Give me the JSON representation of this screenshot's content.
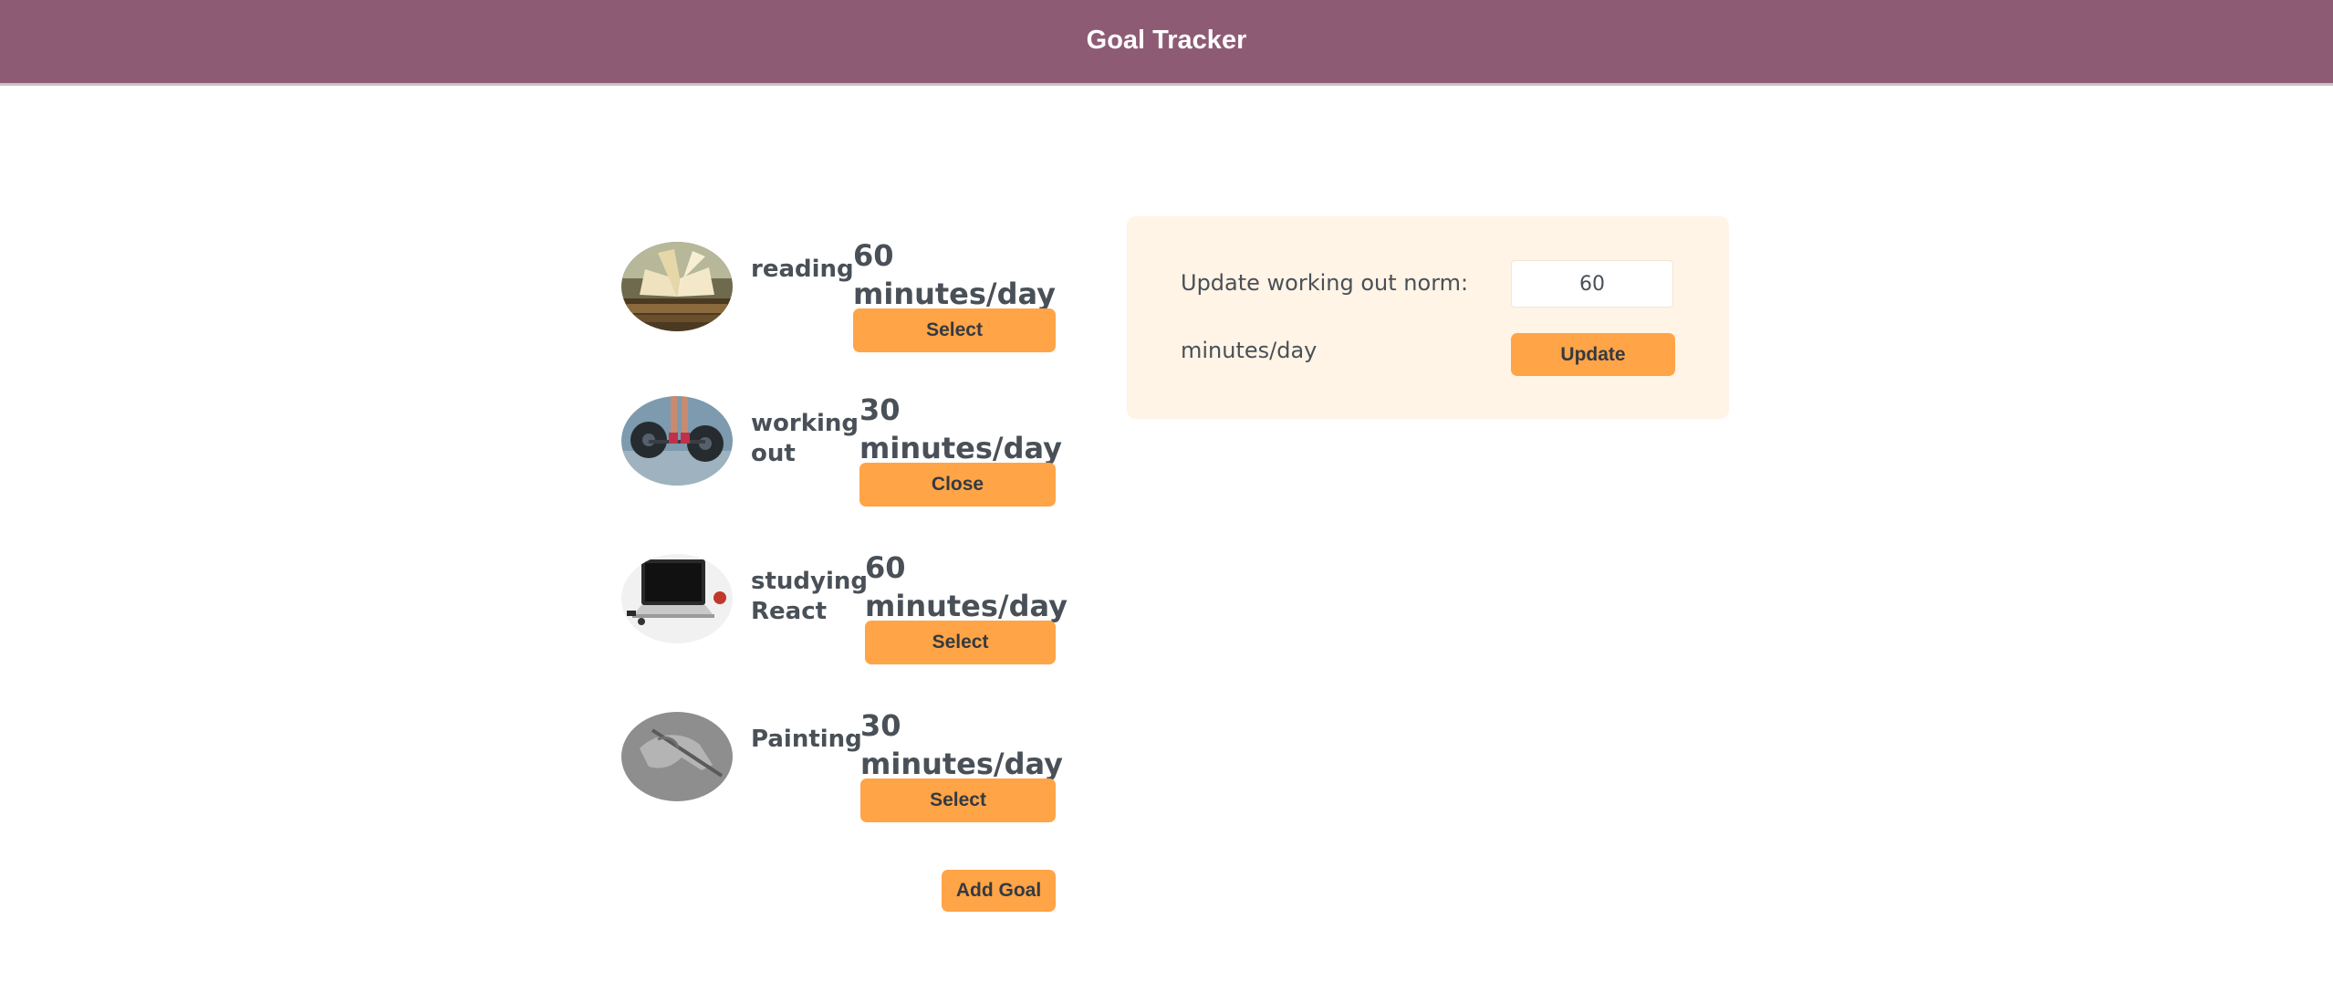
{
  "header": {
    "title": "Goal Tracker"
  },
  "goals": [
    {
      "name": "reading",
      "target": "60 minutes/day",
      "button": "Select",
      "image_icon": "open-book"
    },
    {
      "name": "working out",
      "target": "30 minutes/day",
      "button": "Close",
      "image_icon": "barbell"
    },
    {
      "name": "studying React",
      "target": "60 minutes/day",
      "button": "Select",
      "image_icon": "laptop"
    },
    {
      "name": "Painting",
      "target": "30 minutes/day",
      "button": "Select",
      "image_icon": "hand-pencil"
    }
  ],
  "add_goal_label": "Add Goal",
  "panel": {
    "label": "Update working out norm:",
    "input_value": "60",
    "unit": "minutes/day",
    "update_label": "Update"
  },
  "colors": {
    "header_bg": "#8e5b74",
    "button": "#ffa447",
    "panel_bg": "#fff4e6",
    "text": "#495057"
  }
}
